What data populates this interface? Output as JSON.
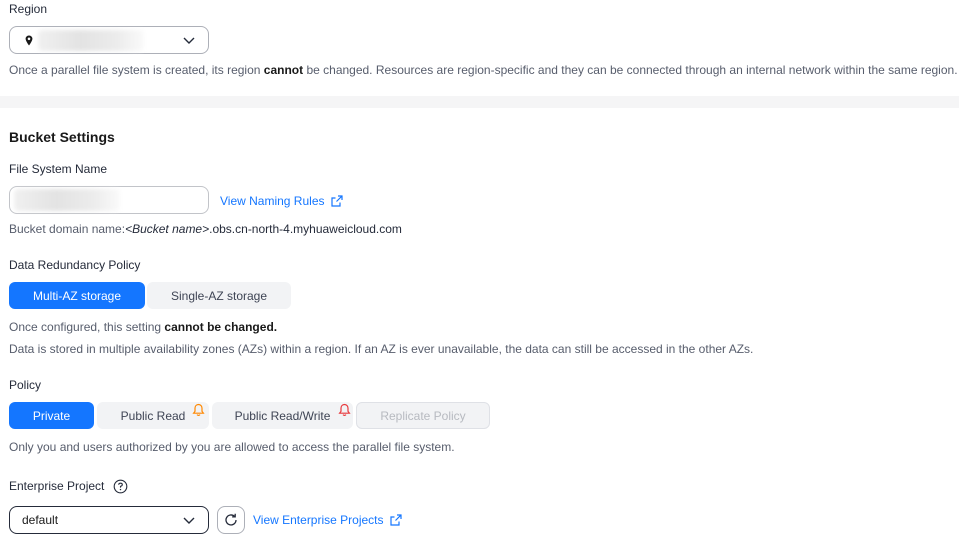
{
  "region": {
    "label": "Region",
    "value": "",
    "note_before": "Once a parallel file system is created, its region ",
    "note_bold": "cannot",
    "note_after": " be changed. Resources are region-specific and they can be connected through an internal network within the same region."
  },
  "bucket_settings": {
    "heading": "Bucket Settings",
    "name_label": "File System Name",
    "name_value": "",
    "naming_rules_link": "View Naming Rules",
    "domain_prefix": "Bucket domain name:",
    "domain_placeholder": "<Bucket name>",
    "domain_suffix": ".obs.cn-north-4.myhuaweicloud.com"
  },
  "redundancy": {
    "label": "Data Redundancy Policy",
    "options": [
      "Multi-AZ storage",
      "Single-AZ storage"
    ],
    "selected": "Multi-AZ storage",
    "note1_before": "Once configured, this setting ",
    "note1_bold": "cannot be changed.",
    "note2": "Data is stored in multiple availability zones (AZs) within a region. If an AZ is ever unavailable, the data can still be accessed in the other AZs."
  },
  "policy": {
    "label": "Policy",
    "options": [
      "Private",
      "Public Read",
      "Public Read/Write",
      "Replicate Policy"
    ],
    "selected": "Private",
    "warning_colors": {
      "public_read": "#ff8800",
      "public_read_write": "#e8393c"
    },
    "note": "Only you and users authorized by you are allowed to access the parallel file system."
  },
  "enterprise_project": {
    "label": "Enterprise Project",
    "value": "default",
    "view_link": "View Enterprise Projects"
  },
  "colors": {
    "accent": "#1476ff",
    "text": "#252b3a",
    "muted": "#575d6c"
  }
}
